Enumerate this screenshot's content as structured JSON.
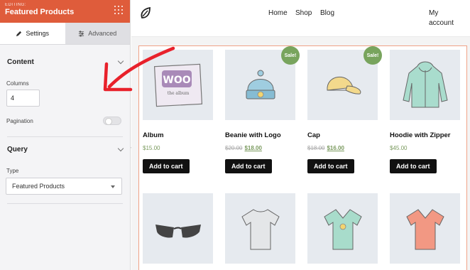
{
  "sidebar": {
    "editing_label": "EDITING:",
    "title": "Featured Products",
    "tabs": [
      {
        "label": "Settings",
        "active": true
      },
      {
        "label": "Advanced",
        "active": false
      }
    ],
    "content_section": {
      "title": "Content",
      "columns_label": "Columns",
      "columns_value": "4",
      "pagination_label": "Pagination"
    },
    "query_section": {
      "title": "Query",
      "type_label": "Type",
      "type_value": "Featured Products"
    }
  },
  "nav": {
    "links": [
      "Home",
      "Shop",
      "Blog"
    ],
    "account_line1": "My",
    "account_line2": "account"
  },
  "products": [
    {
      "name": "Album",
      "price": "$15.00",
      "old_price": "",
      "sale": false
    },
    {
      "name": "Beanie with Logo",
      "price": "$18.00",
      "old_price": "$20.00",
      "sale": true
    },
    {
      "name": "Cap",
      "price": "$16.00",
      "old_price": "$18.00",
      "sale": true
    },
    {
      "name": "Hoodie with Zipper",
      "price": "$45.00",
      "old_price": "",
      "sale": false
    }
  ],
  "sale_badge": "Sale!",
  "add_to_cart_label": "Add to cart",
  "colors": {
    "accent": "#df5c3b",
    "sale": "#78a45d",
    "arrow": "#e8212b"
  }
}
